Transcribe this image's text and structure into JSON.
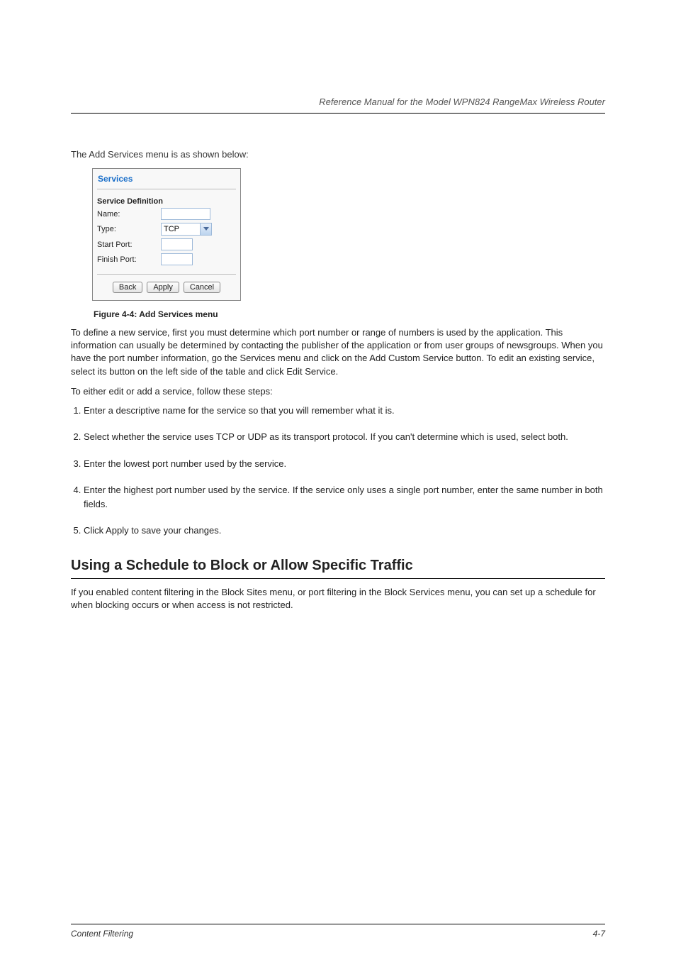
{
  "header": {
    "right": "Reference Manual for the Model WPN824 RangeMax Wireless Router"
  },
  "intro": "The Add Services menu is as shown below:",
  "dialog": {
    "title": "Services",
    "section": "Service Definition",
    "fields": {
      "name_label": "Name:",
      "name_value": "",
      "type_label": "Type:",
      "type_value": "TCP",
      "start_label": "Start Port:",
      "start_value": "",
      "finish_label": "Finish Port:",
      "finish_value": ""
    },
    "buttons": {
      "back": "Back",
      "apply": "Apply",
      "cancel": "Cancel"
    }
  },
  "figure_caption": "Figure 4-4:   Add Services menu",
  "steps_lead": "To define a new service, first you must determine which port number or range of numbers is used by the application. This information can usually be determined by contacting the publisher of the application or from user groups of newsgroups. When you have the port number information, go the Services menu and click on the Add Custom Service button. To edit an existing service, select its button on the left side of the table and click Edit Service.",
  "steps_title": "To either edit or add a service, follow these steps:",
  "steps": [
    "Enter a descriptive name for the service so that you will remember what it is.",
    "Select whether the service uses TCP or UDP as its transport protocol. If you can't determine which is used, select both.",
    "Enter the lowest port number used by the service.",
    "Enter the highest port number used by the service. If the service only uses a single port number, enter the same number in both fields.",
    "Click Apply to save your changes."
  ],
  "section_heading": "Using a Schedule to Block or Allow Specific Traffic",
  "section_body": "If you enabled content filtering in the Block Sites menu, or port filtering in the Block Services menu, you can set up a schedule for when blocking occurs or when access is not restricted.",
  "footer": {
    "left": "Content Filtering",
    "right": "4-7"
  }
}
